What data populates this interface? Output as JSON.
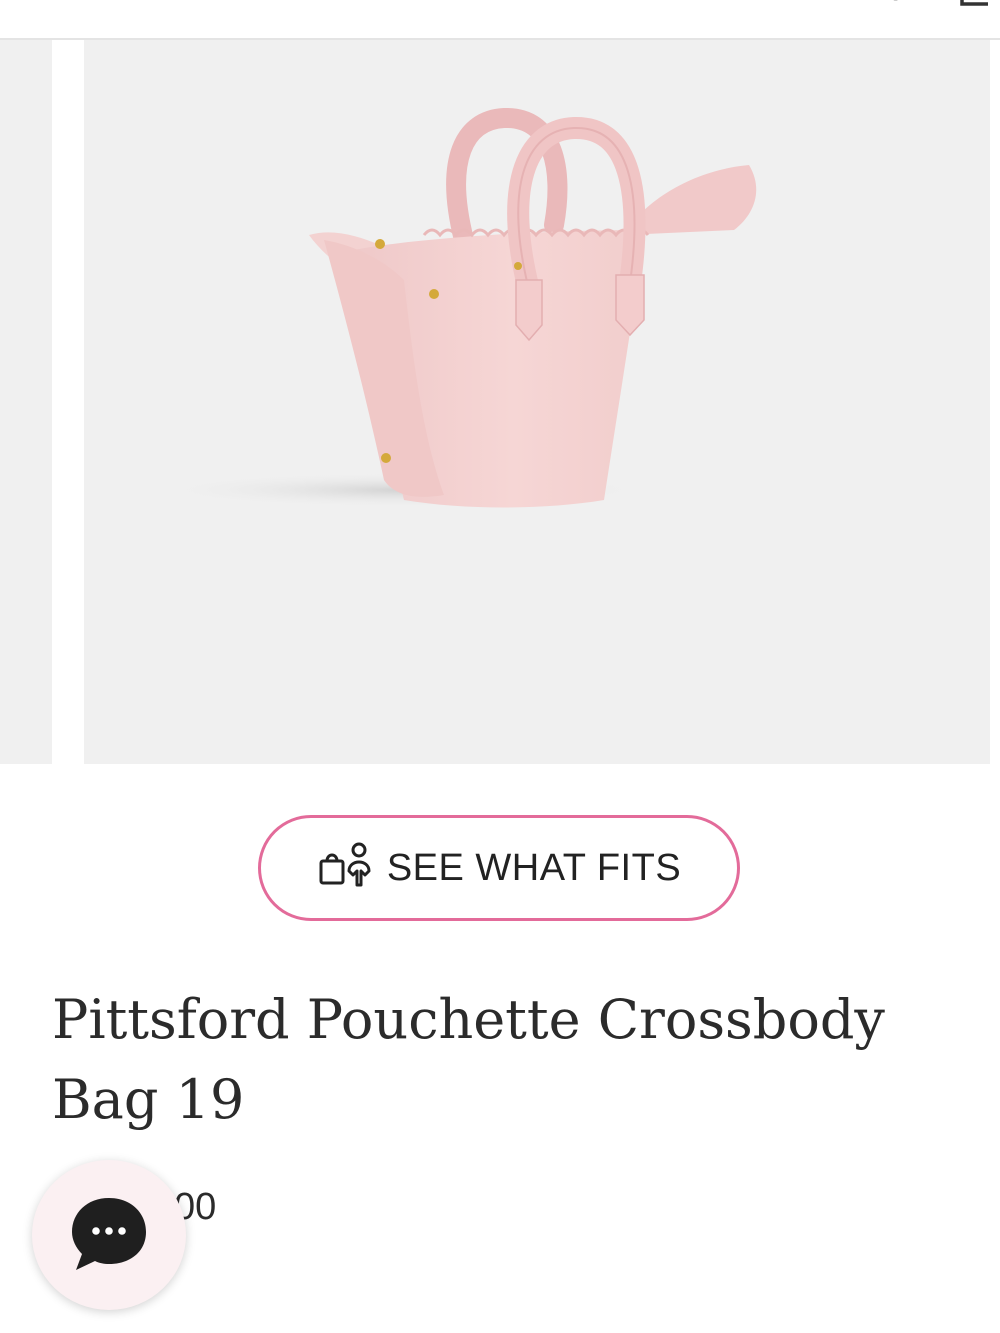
{
  "header": {
    "icons": [
      "search-icon",
      "cart-icon"
    ]
  },
  "gallery": {
    "image_subject": "pink-leather-mini-tote-bag"
  },
  "see_what_fits": {
    "label": "SEE WHAT FITS",
    "icon": "bag-and-person-icon",
    "border_color": "#e36b9a"
  },
  "product": {
    "title": "Pittsford Pouchette Crossbody Bag 19",
    "price_partial": "00"
  },
  "chat": {
    "icon": "chat-bubble-icon",
    "background": "#fbf0f2"
  },
  "colors": {
    "accent": "#e36b9a",
    "bag_pink": "#f2cfcf",
    "image_bg": "#f0f0f0"
  }
}
